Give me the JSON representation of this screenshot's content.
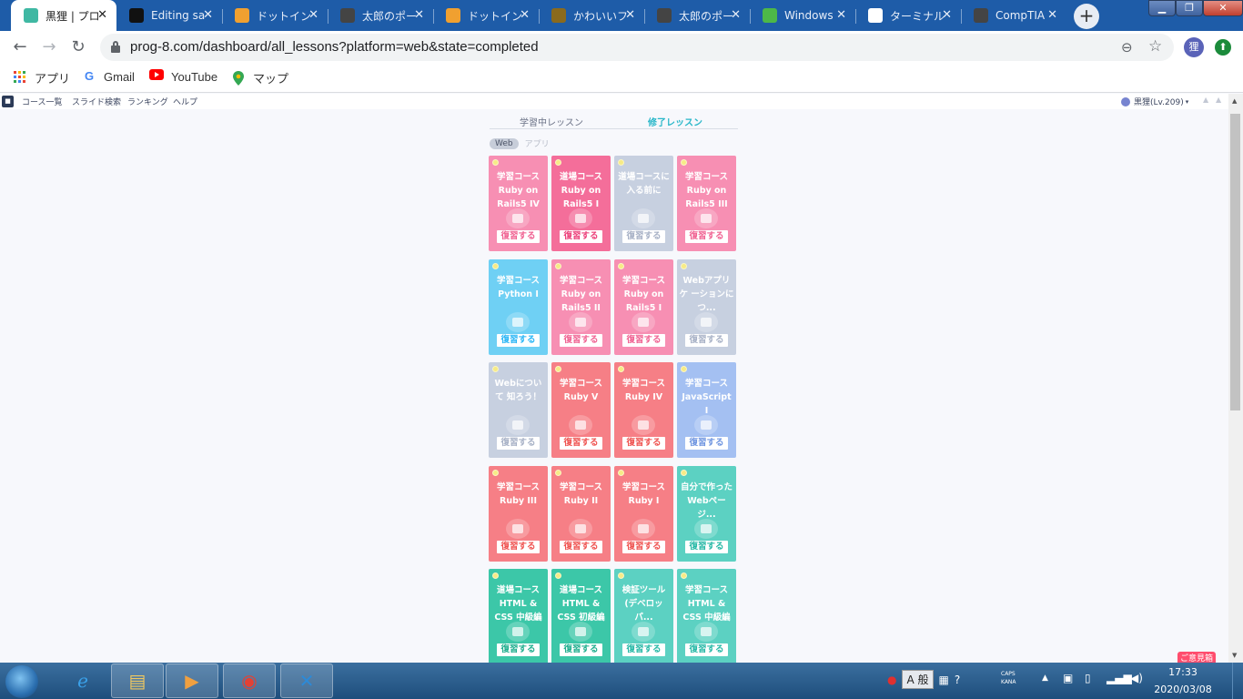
{
  "browser": {
    "tabs": [
      {
        "title": "黒狸 | プロ",
        "icon": "prog8-favicon",
        "color": "#3fb8a3",
        "active": true
      },
      {
        "title": "Editing sa",
        "icon": "github-icon",
        "color": "#111111"
      },
      {
        "title": "ドットイン",
        "icon": "box-favicon",
        "color": "#f0a030"
      },
      {
        "title": "太郎のポー",
        "icon": "globe-icon",
        "color": "#444444"
      },
      {
        "title": "ドットイン",
        "icon": "box-favicon",
        "color": "#f0a030"
      },
      {
        "title": "かわいいフ",
        "icon": "cute-favicon",
        "color": "#8a6a1d"
      },
      {
        "title": "太郎のポー",
        "icon": "globe-icon",
        "color": "#444444"
      },
      {
        "title": "Windows",
        "icon": "q-favicon",
        "color": "#4db848"
      },
      {
        "title": "ターミナル",
        "icon": "wikipedia-icon",
        "color": "#ffffff"
      },
      {
        "title": "CompTIA",
        "icon": "globe-icon",
        "color": "#444444"
      }
    ],
    "close_glyph": "✕",
    "new_tab_glyph": "+",
    "window_controls": {
      "minimize": "▁",
      "maximize": "❐",
      "close": "✕"
    },
    "nav": {
      "back": "←",
      "forward": "→",
      "reload": "↻"
    },
    "url": "prog-8.com/dashboard/all_lessons?platform=web&state=completed",
    "zoom_glyph": "⊖",
    "star_glyph": "☆",
    "profile_initial": "狸",
    "extension_glyph": "⬆",
    "bookmarks": [
      {
        "label": "アプリ",
        "icon": "apps-grid-icon"
      },
      {
        "label": "Gmail",
        "icon": "google-icon"
      },
      {
        "label": "YouTube",
        "icon": "youtube-icon"
      },
      {
        "label": "マップ",
        "icon": "maps-pin-icon"
      }
    ]
  },
  "site": {
    "nav": [
      "コース一覧",
      "スライド検索",
      "ランキング",
      "ヘルプ"
    ],
    "user": "黒狸(Lv.209)",
    "caret": "▾",
    "header_icons": [
      "▲",
      "▲",
      "▲"
    ],
    "lesson_tabs": [
      "学習中レッスン",
      "修了レッスン"
    ],
    "platforms": [
      "Web",
      "アプリ"
    ],
    "review_label": "復習する",
    "corner_badge": "ご意見箱",
    "lessons": [
      {
        "title": "学習コース Ruby on Rails5 IV",
        "color": "#f78fb3",
        "text_color": "#f06292"
      },
      {
        "title": "道場コース Ruby on Rails5 I",
        "color": "#f46e9a",
        "text_color": "#ec407a"
      },
      {
        "title": "道場コースに 入る前に",
        "color": "#c7d0e0",
        "text_color": "#a7b1c6"
      },
      {
        "title": "学習コース Ruby on Rails5 III",
        "color": "#f78fb3",
        "text_color": "#f06292"
      },
      {
        "title": "学習コース Python I",
        "color": "#6fd0f4",
        "text_color": "#29b6f6"
      },
      {
        "title": "学習コース Ruby on Rails5 II",
        "color": "#f78fb3",
        "text_color": "#f06292"
      },
      {
        "title": "学習コース Ruby on Rails5 I",
        "color": "#f78fb3",
        "text_color": "#f06292"
      },
      {
        "title": "Webアプリケ ーションにつ...",
        "color": "#c7d0e0",
        "text_color": "#a7b1c6"
      },
      {
        "title": "Webについて 知ろう！",
        "color": "#c7d0e0",
        "text_color": "#a7b1c6"
      },
      {
        "title": "学習コース Ruby V",
        "color": "#f67f86",
        "text_color": "#ef5350"
      },
      {
        "title": "学習コース Ruby IV",
        "color": "#f67f86",
        "text_color": "#ef5350"
      },
      {
        "title": "学習コース JavaScript I",
        "color": "#a4c0f2",
        "text_color": "#6f95e0"
      },
      {
        "title": "学習コース Ruby III",
        "color": "#f67f86",
        "text_color": "#ef5350"
      },
      {
        "title": "学習コース Ruby II",
        "color": "#f67f86",
        "text_color": "#ef5350"
      },
      {
        "title": "学習コース Ruby I",
        "color": "#f67f86",
        "text_color": "#ef5350"
      },
      {
        "title": "自分で作った Webページ...",
        "color": "#5cd1c2",
        "text_color": "#26b8a6"
      },
      {
        "title": "道場コース HTML & CSS 中級編",
        "color": "#3cc7a8",
        "text_color": "#1fae8e"
      },
      {
        "title": "道場コース HTML & CSS 初級編",
        "color": "#3cc7a8",
        "text_color": "#1fae8e"
      },
      {
        "title": "検証ツール (デベロッパ...",
        "color": "#5cd1c2",
        "text_color": "#26b8a6"
      },
      {
        "title": "学習コース HTML & CSS 中級編",
        "color": "#5cd1c2",
        "text_color": "#26b8a6"
      }
    ]
  },
  "taskbar": {
    "apps": [
      {
        "name": "internet-explorer-icon",
        "glyph": "ℯ",
        "color": "#3aa0e8"
      },
      {
        "name": "file-explorer-icon",
        "glyph": "▤",
        "color": "#f0c860"
      },
      {
        "name": "media-player-icon",
        "glyph": "▶",
        "color": "#f0a040"
      },
      {
        "name": "chrome-icon",
        "glyph": "◉",
        "color": "#e44134"
      },
      {
        "name": "vscode-icon",
        "glyph": "✕",
        "color": "#2c8ad8"
      }
    ],
    "ime_text": "A 般",
    "caps_text": "CAPS",
    "kana_text": "KANA",
    "time": "17:33",
    "date": "2020/03/08"
  }
}
